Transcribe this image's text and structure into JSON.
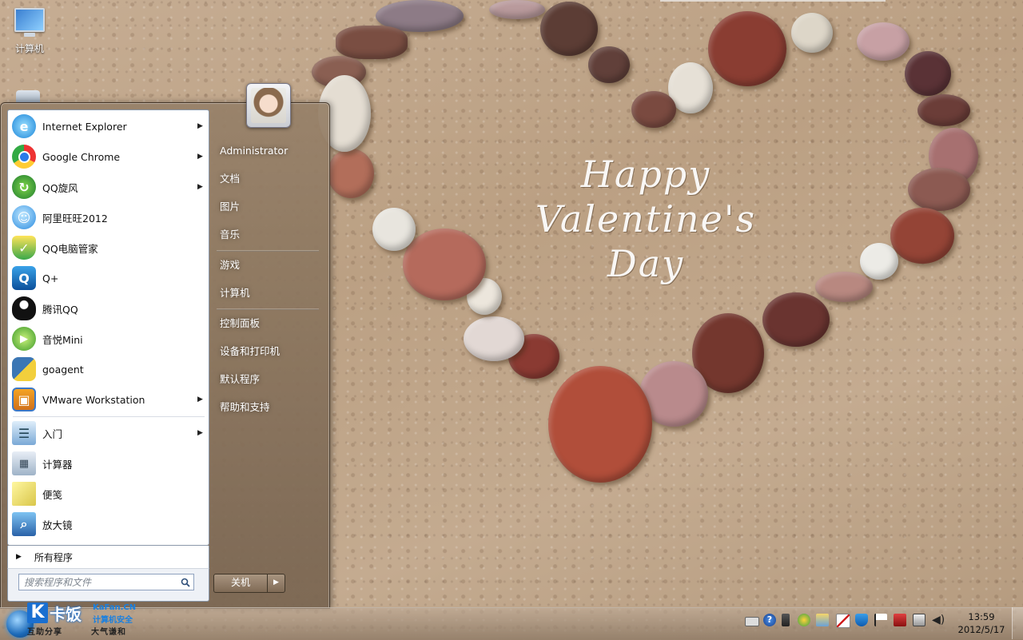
{
  "desktop": {
    "icons": [
      {
        "label": "计算机",
        "icon": "computer-icon"
      },
      {
        "label": "",
        "icon": "recycle-bin-icon"
      }
    ],
    "wallpaper_text": [
      "Happy Valentine's",
      "Day"
    ]
  },
  "start_menu": {
    "pinned": [
      {
        "label": "Internet Explorer",
        "icon": "internet-explorer-icon",
        "submenu": true
      },
      {
        "label": "Google Chrome",
        "icon": "chrome-icon",
        "submenu": true
      },
      {
        "label": "QQ旋风",
        "icon": "qq-xuanfeng-icon",
        "submenu": true
      },
      {
        "label": "阿里旺旺2012",
        "icon": "aliwangwang-icon",
        "submenu": false
      },
      {
        "label": "QQ电脑管家",
        "icon": "qq-pc-manager-icon",
        "submenu": false
      },
      {
        "label": "Q+",
        "icon": "qplus-icon",
        "submenu": false
      },
      {
        "label": "腾讯QQ",
        "icon": "qq-penguin-icon",
        "submenu": false
      },
      {
        "label": "音悦Mini",
        "icon": "yinyue-mini-icon",
        "submenu": false
      },
      {
        "label": "goagent",
        "icon": "python-icon",
        "submenu": false
      },
      {
        "label": "VMware Workstation",
        "icon": "vmware-icon",
        "submenu": true
      }
    ],
    "recent": [
      {
        "label": "入门",
        "icon": "getting-started-icon",
        "submenu": true
      },
      {
        "label": "计算器",
        "icon": "calculator-icon",
        "submenu": false
      },
      {
        "label": "便笺",
        "icon": "sticky-notes-icon",
        "submenu": false
      },
      {
        "label": "放大镜",
        "icon": "magnifier-icon",
        "submenu": false
      }
    ],
    "all_programs": "所有程序",
    "search_placeholder": "搜索程序和文件",
    "user": "Administrator",
    "right_items_group1": [
      "文档",
      "图片",
      "音乐"
    ],
    "right_items_group2": [
      "游戏",
      "计算机"
    ],
    "right_items_group3": [
      "控制面板",
      "设备和打印机",
      "默认程序",
      "帮助和支持"
    ],
    "shutdown_label": "关机"
  },
  "taskbar": {
    "watermark": {
      "logo_letter": "K",
      "name": "卡饭",
      "site": "KaFan.CN",
      "tagline": "计算机安全",
      "bottom_left": "互助分享",
      "bottom_right": "大气谦和"
    },
    "clock_time": "13:59",
    "clock_date": "2012/5/17",
    "tray_icons": [
      "keyboard-icon",
      "help-icon",
      "usb-icon",
      "qq-tray-icon",
      "storage-icon",
      "defense-icon",
      "shield-icon",
      "action-center-flag-icon",
      "security-alert-icon",
      "network-icon",
      "volume-icon"
    ]
  }
}
